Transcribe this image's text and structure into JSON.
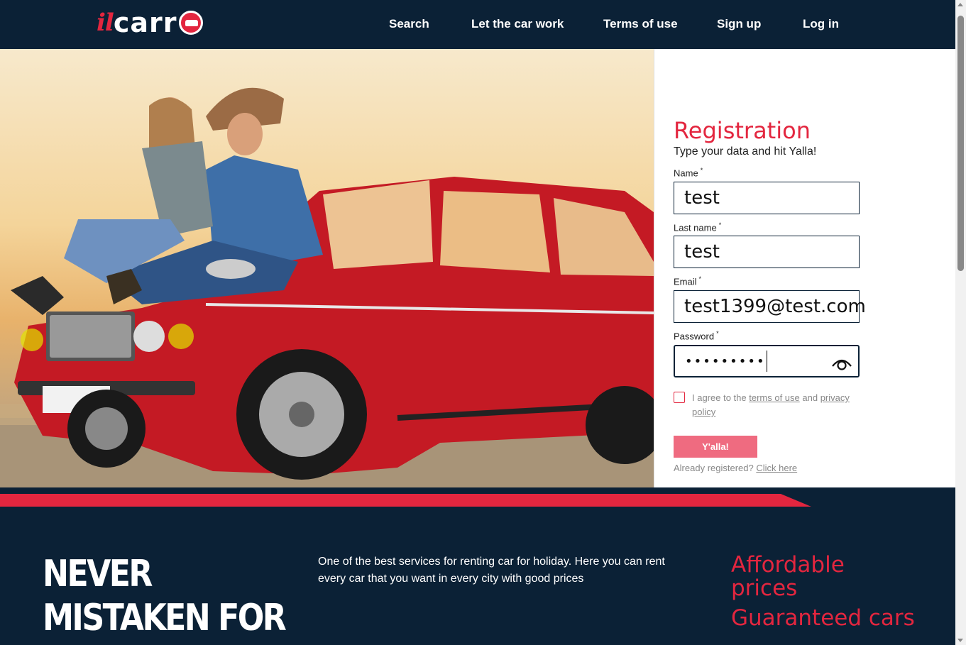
{
  "header": {
    "logo_il": "il",
    "logo_carr": "carr",
    "nav": [
      "Search",
      "Let the car work",
      "Terms of use",
      "Sign up",
      "Log in"
    ]
  },
  "form": {
    "title": "Registration",
    "subtitle": "Type your data and hit Yalla!",
    "name_label": "Name",
    "name_value": "test",
    "lastname_label": "Last name",
    "lastname_value": "test",
    "email_label": "Email",
    "email_value": "test1399@test.com",
    "password_label": "Password",
    "password_value": "•••••••••",
    "required_mark": "*",
    "agree_prefix": "I agree to the ",
    "terms_link": "terms of use",
    "agree_and": " and ",
    "privacy_link": "privacy policy",
    "submit_label": "Y'alla!",
    "already_text": "Already registered? ",
    "click_here": "Click here"
  },
  "footer": {
    "never_line1": "NEVER",
    "never_line2": "MISTAKEN FOR",
    "description": "One of the best services for renting car for holiday. Here you can rent every car that you want in every city with good prices",
    "affordable": "Affordable prices",
    "guaranteed": "Guaranteed cars"
  },
  "colors": {
    "navy": "#0b2136",
    "brand_red": "#e3263f",
    "button_pink": "#ef6b80"
  }
}
